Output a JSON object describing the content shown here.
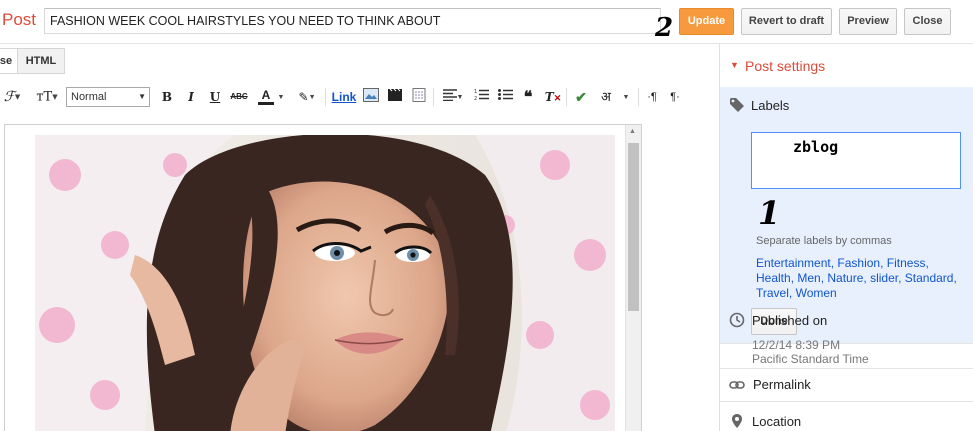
{
  "header": {
    "post_label": "Post",
    "title_value": "FASHION WEEK COOL HAIRSTYLES YOU NEED TO THINK ABOUT",
    "buttons": {
      "update": "Update",
      "revert": "Revert to draft",
      "preview": "Preview",
      "close": "Close"
    },
    "update_color": "#f79a3e"
  },
  "annotations": {
    "step_two": "2",
    "step_one": "1"
  },
  "mode_tabs": {
    "compose": "se",
    "html": "HTML"
  },
  "toolbar": {
    "font_family_icon": "font-icon",
    "font_size_icon": "font-size-icon",
    "format_select_value": "Normal",
    "bold": "B",
    "italic": "I",
    "underline": "U",
    "strike": "ABC",
    "text_color": "A",
    "link": "Link",
    "hindi": "अ",
    "accent_color": "#1155cc"
  },
  "sidebar": {
    "post_settings_title": "Post settings",
    "labels": {
      "title": "Labels",
      "value": "zblog",
      "hint": "Separate labels by commas",
      "suggestions": [
        "Entertainment",
        "Fashion",
        "Fitness",
        "Health",
        "Men",
        "Nature",
        "slider",
        "Standard",
        "Travel",
        "Women"
      ],
      "done_label": "Done"
    },
    "published": {
      "title": "Published on",
      "date": "12/2/14 8:39 PM",
      "timezone": "Pacific Standard Time"
    },
    "permalink": {
      "title": "Permalink"
    },
    "location": {
      "title": "Location"
    },
    "brand_color": "#dd4b39"
  }
}
